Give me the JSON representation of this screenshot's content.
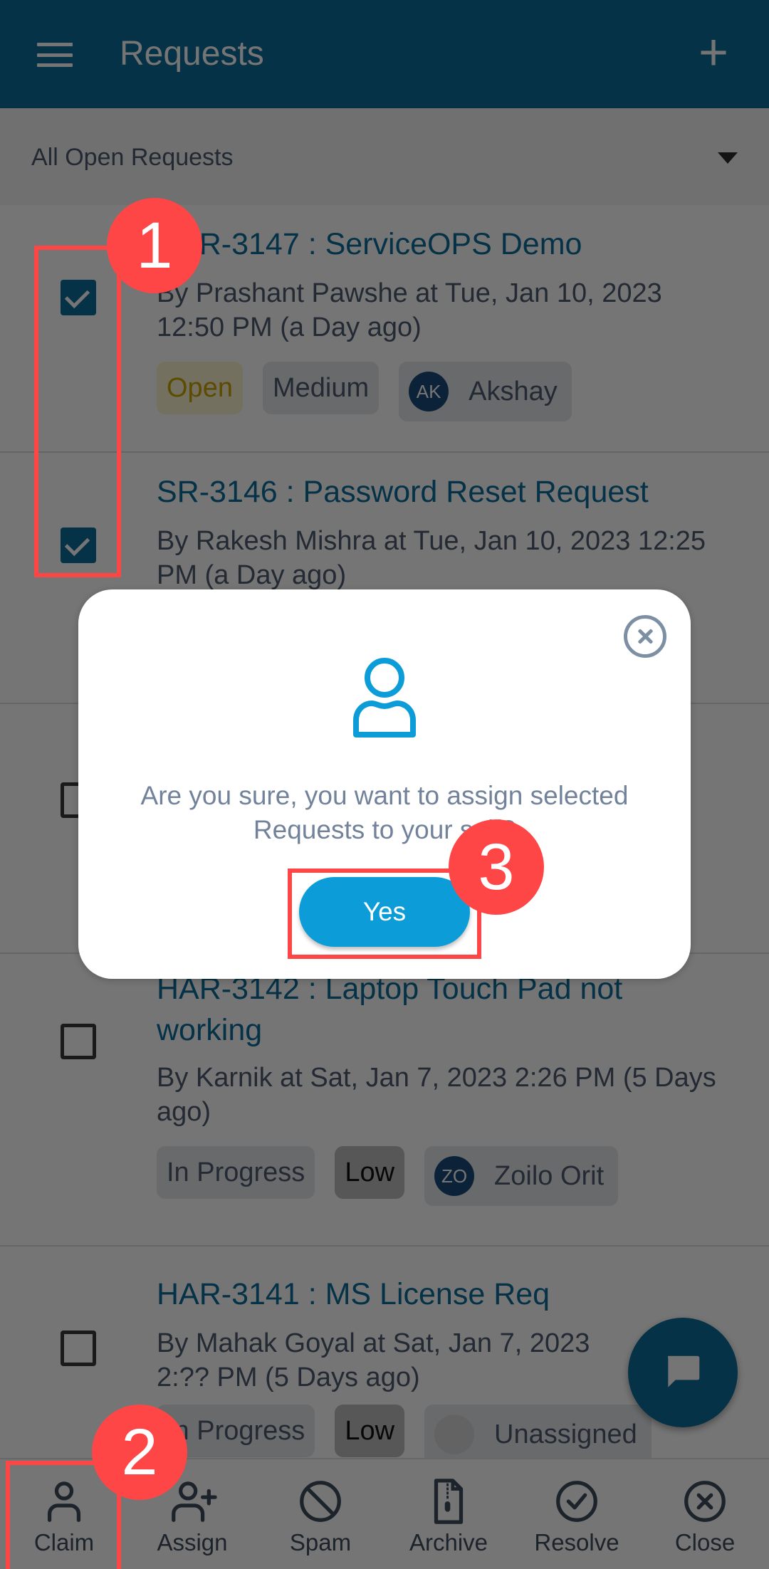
{
  "appbar": {
    "title": "Requests",
    "menu_icon": "hamburger-menu-icon",
    "add_label": "+",
    "colors": {
      "primary": "#0b6d9a"
    }
  },
  "filter": {
    "selected": "All Open Requests"
  },
  "requests": [
    {
      "title": "HAR-3147 : ServiceOPS Demo",
      "meta": "By Prashant Pawshe at Tue, Jan 10, 2023 12:50 PM (a Day ago)",
      "checked": true,
      "status": "Open",
      "priority": "Medium",
      "assignee_initials": "AK",
      "assignee": "Akshay"
    },
    {
      "title": "SR-3146 : Password Reset Request",
      "meta": "By Rakesh Mishra at Tue, Jan 10, 2023 12:25 PM (a Day ago)",
      "checked": true
    },
    {
      "checked": false
    },
    {
      "title": "HAR-3142 : Laptop Touch Pad not working",
      "meta": "By Karnik at Sat, Jan 7, 2023 2:26 PM (5 Days ago)",
      "checked": false,
      "status": "In Progress",
      "priority": "Low",
      "assignee_initials": "ZO",
      "assignee": "Zoilo Orit"
    },
    {
      "title": "HAR-3141 : MS License Req",
      "meta": "By Mahak Goyal at Sat, Jan 7, 2023 2:?? PM (5 Days ago)",
      "checked": false,
      "status": "In Progress",
      "priority": "Low",
      "assignee": "Unassigned"
    }
  ],
  "bottom_actions": [
    {
      "label": "Claim",
      "icon": "user-icon"
    },
    {
      "label": "Assign",
      "icon": "user-plus-icon"
    },
    {
      "label": "Spam",
      "icon": "block-icon"
    },
    {
      "label": "Archive",
      "icon": "archive-file-icon"
    },
    {
      "label": "Resolve",
      "icon": "check-circle-icon"
    },
    {
      "label": "Close",
      "icon": "close-circle-icon"
    }
  ],
  "dialog": {
    "message": "Are you sure, you want to assign selected Requests to your self?",
    "confirm_label": "Yes",
    "icon": "user-icon",
    "close_icon": "close-circle-icon"
  },
  "annotations": [
    {
      "number": "1",
      "target": "selected checkboxes"
    },
    {
      "number": "2",
      "target": "Claim"
    },
    {
      "number": "3",
      "target": "Yes"
    }
  ]
}
